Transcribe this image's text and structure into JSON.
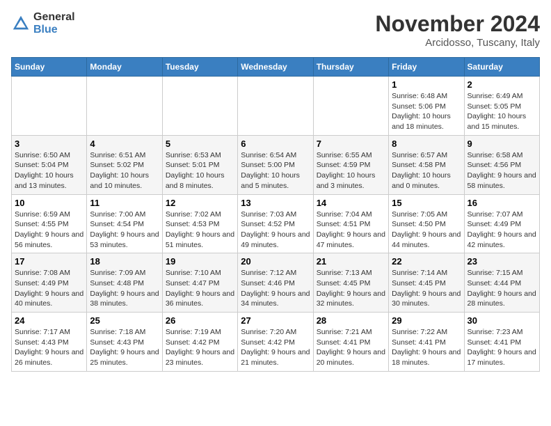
{
  "logo": {
    "general": "General",
    "blue": "Blue"
  },
  "title": "November 2024",
  "location": "Arcidosso, Tuscany, Italy",
  "weekdays": [
    "Sunday",
    "Monday",
    "Tuesday",
    "Wednesday",
    "Thursday",
    "Friday",
    "Saturday"
  ],
  "weeks": [
    [
      {
        "day": "",
        "info": ""
      },
      {
        "day": "",
        "info": ""
      },
      {
        "day": "",
        "info": ""
      },
      {
        "day": "",
        "info": ""
      },
      {
        "day": "",
        "info": ""
      },
      {
        "day": "1",
        "info": "Sunrise: 6:48 AM\nSunset: 5:06 PM\nDaylight: 10 hours and 18 minutes."
      },
      {
        "day": "2",
        "info": "Sunrise: 6:49 AM\nSunset: 5:05 PM\nDaylight: 10 hours and 15 minutes."
      }
    ],
    [
      {
        "day": "3",
        "info": "Sunrise: 6:50 AM\nSunset: 5:04 PM\nDaylight: 10 hours and 13 minutes."
      },
      {
        "day": "4",
        "info": "Sunrise: 6:51 AM\nSunset: 5:02 PM\nDaylight: 10 hours and 10 minutes."
      },
      {
        "day": "5",
        "info": "Sunrise: 6:53 AM\nSunset: 5:01 PM\nDaylight: 10 hours and 8 minutes."
      },
      {
        "day": "6",
        "info": "Sunrise: 6:54 AM\nSunset: 5:00 PM\nDaylight: 10 hours and 5 minutes."
      },
      {
        "day": "7",
        "info": "Sunrise: 6:55 AM\nSunset: 4:59 PM\nDaylight: 10 hours and 3 minutes."
      },
      {
        "day": "8",
        "info": "Sunrise: 6:57 AM\nSunset: 4:58 PM\nDaylight: 10 hours and 0 minutes."
      },
      {
        "day": "9",
        "info": "Sunrise: 6:58 AM\nSunset: 4:56 PM\nDaylight: 9 hours and 58 minutes."
      }
    ],
    [
      {
        "day": "10",
        "info": "Sunrise: 6:59 AM\nSunset: 4:55 PM\nDaylight: 9 hours and 56 minutes."
      },
      {
        "day": "11",
        "info": "Sunrise: 7:00 AM\nSunset: 4:54 PM\nDaylight: 9 hours and 53 minutes."
      },
      {
        "day": "12",
        "info": "Sunrise: 7:02 AM\nSunset: 4:53 PM\nDaylight: 9 hours and 51 minutes."
      },
      {
        "day": "13",
        "info": "Sunrise: 7:03 AM\nSunset: 4:52 PM\nDaylight: 9 hours and 49 minutes."
      },
      {
        "day": "14",
        "info": "Sunrise: 7:04 AM\nSunset: 4:51 PM\nDaylight: 9 hours and 47 minutes."
      },
      {
        "day": "15",
        "info": "Sunrise: 7:05 AM\nSunset: 4:50 PM\nDaylight: 9 hours and 44 minutes."
      },
      {
        "day": "16",
        "info": "Sunrise: 7:07 AM\nSunset: 4:49 PM\nDaylight: 9 hours and 42 minutes."
      }
    ],
    [
      {
        "day": "17",
        "info": "Sunrise: 7:08 AM\nSunset: 4:49 PM\nDaylight: 9 hours and 40 minutes."
      },
      {
        "day": "18",
        "info": "Sunrise: 7:09 AM\nSunset: 4:48 PM\nDaylight: 9 hours and 38 minutes."
      },
      {
        "day": "19",
        "info": "Sunrise: 7:10 AM\nSunset: 4:47 PM\nDaylight: 9 hours and 36 minutes."
      },
      {
        "day": "20",
        "info": "Sunrise: 7:12 AM\nSunset: 4:46 PM\nDaylight: 9 hours and 34 minutes."
      },
      {
        "day": "21",
        "info": "Sunrise: 7:13 AM\nSunset: 4:45 PM\nDaylight: 9 hours and 32 minutes."
      },
      {
        "day": "22",
        "info": "Sunrise: 7:14 AM\nSunset: 4:45 PM\nDaylight: 9 hours and 30 minutes."
      },
      {
        "day": "23",
        "info": "Sunrise: 7:15 AM\nSunset: 4:44 PM\nDaylight: 9 hours and 28 minutes."
      }
    ],
    [
      {
        "day": "24",
        "info": "Sunrise: 7:17 AM\nSunset: 4:43 PM\nDaylight: 9 hours and 26 minutes."
      },
      {
        "day": "25",
        "info": "Sunrise: 7:18 AM\nSunset: 4:43 PM\nDaylight: 9 hours and 25 minutes."
      },
      {
        "day": "26",
        "info": "Sunrise: 7:19 AM\nSunset: 4:42 PM\nDaylight: 9 hours and 23 minutes."
      },
      {
        "day": "27",
        "info": "Sunrise: 7:20 AM\nSunset: 4:42 PM\nDaylight: 9 hours and 21 minutes."
      },
      {
        "day": "28",
        "info": "Sunrise: 7:21 AM\nSunset: 4:41 PM\nDaylight: 9 hours and 20 minutes."
      },
      {
        "day": "29",
        "info": "Sunrise: 7:22 AM\nSunset: 4:41 PM\nDaylight: 9 hours and 18 minutes."
      },
      {
        "day": "30",
        "info": "Sunrise: 7:23 AM\nSunset: 4:41 PM\nDaylight: 9 hours and 17 minutes."
      }
    ]
  ]
}
